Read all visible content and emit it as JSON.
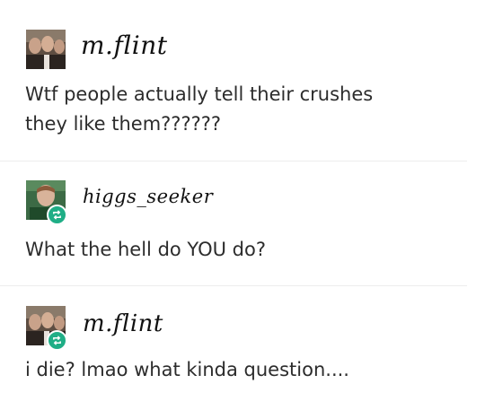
{
  "posts": [
    {
      "username": "m.flint",
      "avatar_icon": "avatar-photo-icon",
      "reblog": false,
      "lines": [
        "Wtf people actually tell their crushes",
        "they like them??????"
      ]
    },
    {
      "username": "higgs_seeker",
      "avatar_icon": "avatar-photo-icon",
      "reblog": true,
      "lines": [
        "What the hell do YOU do?"
      ]
    },
    {
      "username": "m.flint",
      "avatar_icon": "avatar-photo-icon",
      "reblog": true,
      "lines": [
        "i die? lmao what kinda question...."
      ]
    }
  ],
  "colors": {
    "text": "#2c2c2c",
    "reblog_badge": "#1fae86",
    "divider": "#ededed"
  }
}
